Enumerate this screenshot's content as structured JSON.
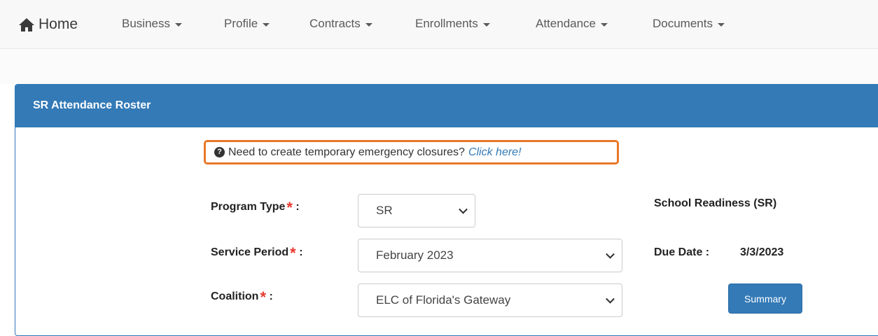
{
  "navbar": {
    "home_label": "Home",
    "home_icon": "home-icon",
    "items": [
      {
        "label": "Business"
      },
      {
        "label": "Profile"
      },
      {
        "label": "Contracts"
      },
      {
        "label": "Enrollments"
      },
      {
        "label": "Attendance"
      },
      {
        "label": "Documents"
      }
    ]
  },
  "panel": {
    "title": "SR Attendance Roster",
    "heading_color": "#337ab7"
  },
  "notice": {
    "icon": "question-circle-icon",
    "text": "Need to create temporary emergency closures?",
    "link": "Click here!",
    "highlight_color": "#e8782a"
  },
  "form": {
    "required_marker": "*",
    "program_type": {
      "label": "Program Type",
      "value": "SR"
    },
    "service_period": {
      "label": "Service Period",
      "value": "February 2023"
    },
    "coalition": {
      "label": "Coalition",
      "value": "ELC of Florida's Gateway"
    },
    "colon": ":"
  },
  "info": {
    "program_name": "School Readiness (SR)",
    "due_date_label": "Due Date :",
    "due_date_value": "3/3/2023"
  },
  "buttons": {
    "summary": "Summary"
  }
}
